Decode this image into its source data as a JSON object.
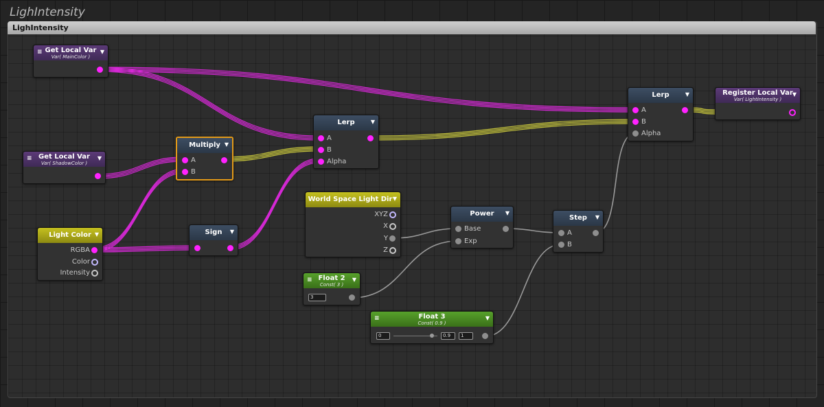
{
  "graph_title": "LighIntensity",
  "group_title": "LighIntensity",
  "colors": {
    "wire_color_float4": "#d628d6",
    "wire_color_float": "#c4c33b",
    "wire_color_scalar": "#9a9a9a",
    "selected_outline": "#e39a18"
  },
  "nodes": {
    "get_main": {
      "title": "Get Local Var",
      "subtitle": "Var( MainColor )",
      "icon": "dropdown-icon"
    },
    "get_shadow": {
      "title": "Get Local Var",
      "subtitle": "Var( ShadowColor )",
      "icon": "dropdown-icon"
    },
    "light_color": {
      "title": "Light Color",
      "ports": [
        "RGBA",
        "Color",
        "Intensity"
      ]
    },
    "multiply": {
      "title": "Multiply",
      "ports": [
        "A",
        "B"
      ]
    },
    "sign": {
      "title": "Sign"
    },
    "lerp1": {
      "title": "Lerp",
      "ports": [
        "A",
        "B",
        "Alpha"
      ]
    },
    "wsld": {
      "title": "World Space Light Dir",
      "ports": [
        "XYZ",
        "X",
        "Y",
        "Z"
      ]
    },
    "power": {
      "title": "Power",
      "ports": [
        "Base",
        "Exp"
      ]
    },
    "step": {
      "title": "Step",
      "ports": [
        "A",
        "B"
      ]
    },
    "float2": {
      "title": "Float 2",
      "subtitle": "Const( 3 )",
      "value": "3"
    },
    "float3": {
      "title": "Float 3",
      "subtitle": "Const( 0.9 )",
      "min": "0",
      "value": "0.9",
      "max": "1",
      "slider_fraction": 0.9
    },
    "lerp2": {
      "title": "Lerp",
      "ports": [
        "A",
        "B",
        "Alpha"
      ]
    },
    "register": {
      "title": "Register Local Var",
      "subtitle": "Var( LightIntensity )"
    }
  }
}
